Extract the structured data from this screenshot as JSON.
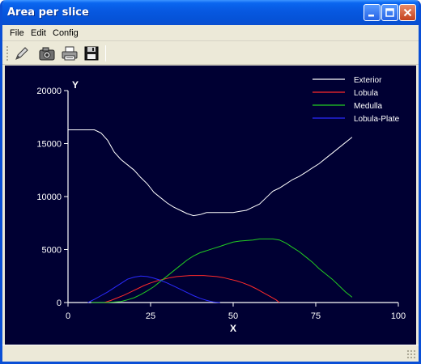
{
  "window": {
    "title": "Area per slice"
  },
  "menu": {
    "items": [
      "File",
      "Edit",
      "Config"
    ]
  },
  "toolbar": {
    "icons": [
      "pencil-icon",
      "camera-icon",
      "printer-icon",
      "floppy-disk-icon"
    ]
  },
  "colors": {
    "plot_background": "#000033",
    "axis": "#ffffff",
    "exterior": "#ffffff",
    "lobula": "#ff2a2a",
    "medulla": "#22cc22",
    "lobula_plate": "#2a2aff"
  },
  "chart_data": {
    "type": "line",
    "xlabel": "X",
    "ylabel": "Y",
    "xlim": [
      0,
      100
    ],
    "ylim": [
      0,
      20000
    ],
    "x_ticks": [
      0,
      25,
      50,
      75,
      100
    ],
    "y_ticks": [
      0,
      5000,
      10000,
      15000,
      20000
    ],
    "legend_position": "top-right",
    "grid": false,
    "series": [
      {
        "name": "Exterior",
        "color": "#ffffff",
        "x": [
          0,
          2,
          4,
          6,
          8,
          10,
          12,
          14,
          16,
          18,
          20,
          22,
          24,
          25,
          26,
          28,
          30,
          32,
          34,
          36,
          38,
          40,
          42,
          44,
          46,
          48,
          50,
          52,
          54,
          56,
          58,
          60,
          62,
          64,
          66,
          68,
          70,
          72,
          74,
          76,
          78,
          80,
          82,
          84,
          86
        ],
        "y": [
          16300,
          16300,
          16300,
          16300,
          16300,
          16000,
          15300,
          14200,
          13500,
          13000,
          12500,
          11800,
          11200,
          10800,
          10400,
          9900,
          9400,
          9000,
          8700,
          8400,
          8200,
          8300,
          8500,
          8500,
          8500,
          8500,
          8500,
          8600,
          8700,
          9000,
          9300,
          9900,
          10500,
          10800,
          11200,
          11600,
          11900,
          12300,
          12700,
          13100,
          13600,
          14100,
          14600,
          15100,
          15600
        ]
      },
      {
        "name": "Lobula",
        "color": "#ff2a2a",
        "x": [
          11,
          13,
          15,
          17,
          19,
          21,
          23,
          25,
          27,
          29,
          31,
          33,
          35,
          37,
          39,
          41,
          43,
          45,
          47,
          49,
          51,
          53,
          55,
          57,
          59,
          61,
          63,
          64
        ],
        "y": [
          0,
          200,
          450,
          700,
          1000,
          1300,
          1600,
          1850,
          2050,
          2200,
          2350,
          2450,
          2500,
          2550,
          2550,
          2550,
          2500,
          2450,
          2350,
          2200,
          2050,
          1850,
          1600,
          1300,
          950,
          600,
          250,
          0
        ]
      },
      {
        "name": "Medulla",
        "color": "#22cc22",
        "x": [
          7,
          12,
          16,
          18,
          20,
          22,
          24,
          26,
          28,
          30,
          32,
          34,
          36,
          38,
          40,
          42,
          44,
          46,
          48,
          50,
          52,
          54,
          56,
          58,
          60,
          62,
          64,
          66,
          68,
          70,
          72,
          74,
          76,
          78,
          80,
          82,
          84,
          86
        ],
        "y": [
          0,
          0,
          100,
          250,
          450,
          750,
          1100,
          1500,
          2000,
          2500,
          3000,
          3500,
          4000,
          4400,
          4700,
          4900,
          5100,
          5300,
          5500,
          5700,
          5800,
          5850,
          5900,
          6000,
          6000,
          6000,
          5900,
          5600,
          5200,
          4800,
          4300,
          3800,
          3200,
          2700,
          2200,
          1600,
          1000,
          500
        ]
      },
      {
        "name": "Lobula-Plate",
        "color": "#2a2aff",
        "x": [
          6,
          8,
          10,
          12,
          14,
          16,
          18,
          20,
          22,
          24,
          26,
          28,
          30,
          32,
          34,
          36,
          38,
          40,
          42,
          44,
          46
        ],
        "y": [
          0,
          300,
          650,
          1000,
          1400,
          1800,
          2200,
          2400,
          2500,
          2450,
          2300,
          2100,
          1850,
          1550,
          1250,
          950,
          650,
          400,
          200,
          50,
          0
        ]
      }
    ]
  }
}
